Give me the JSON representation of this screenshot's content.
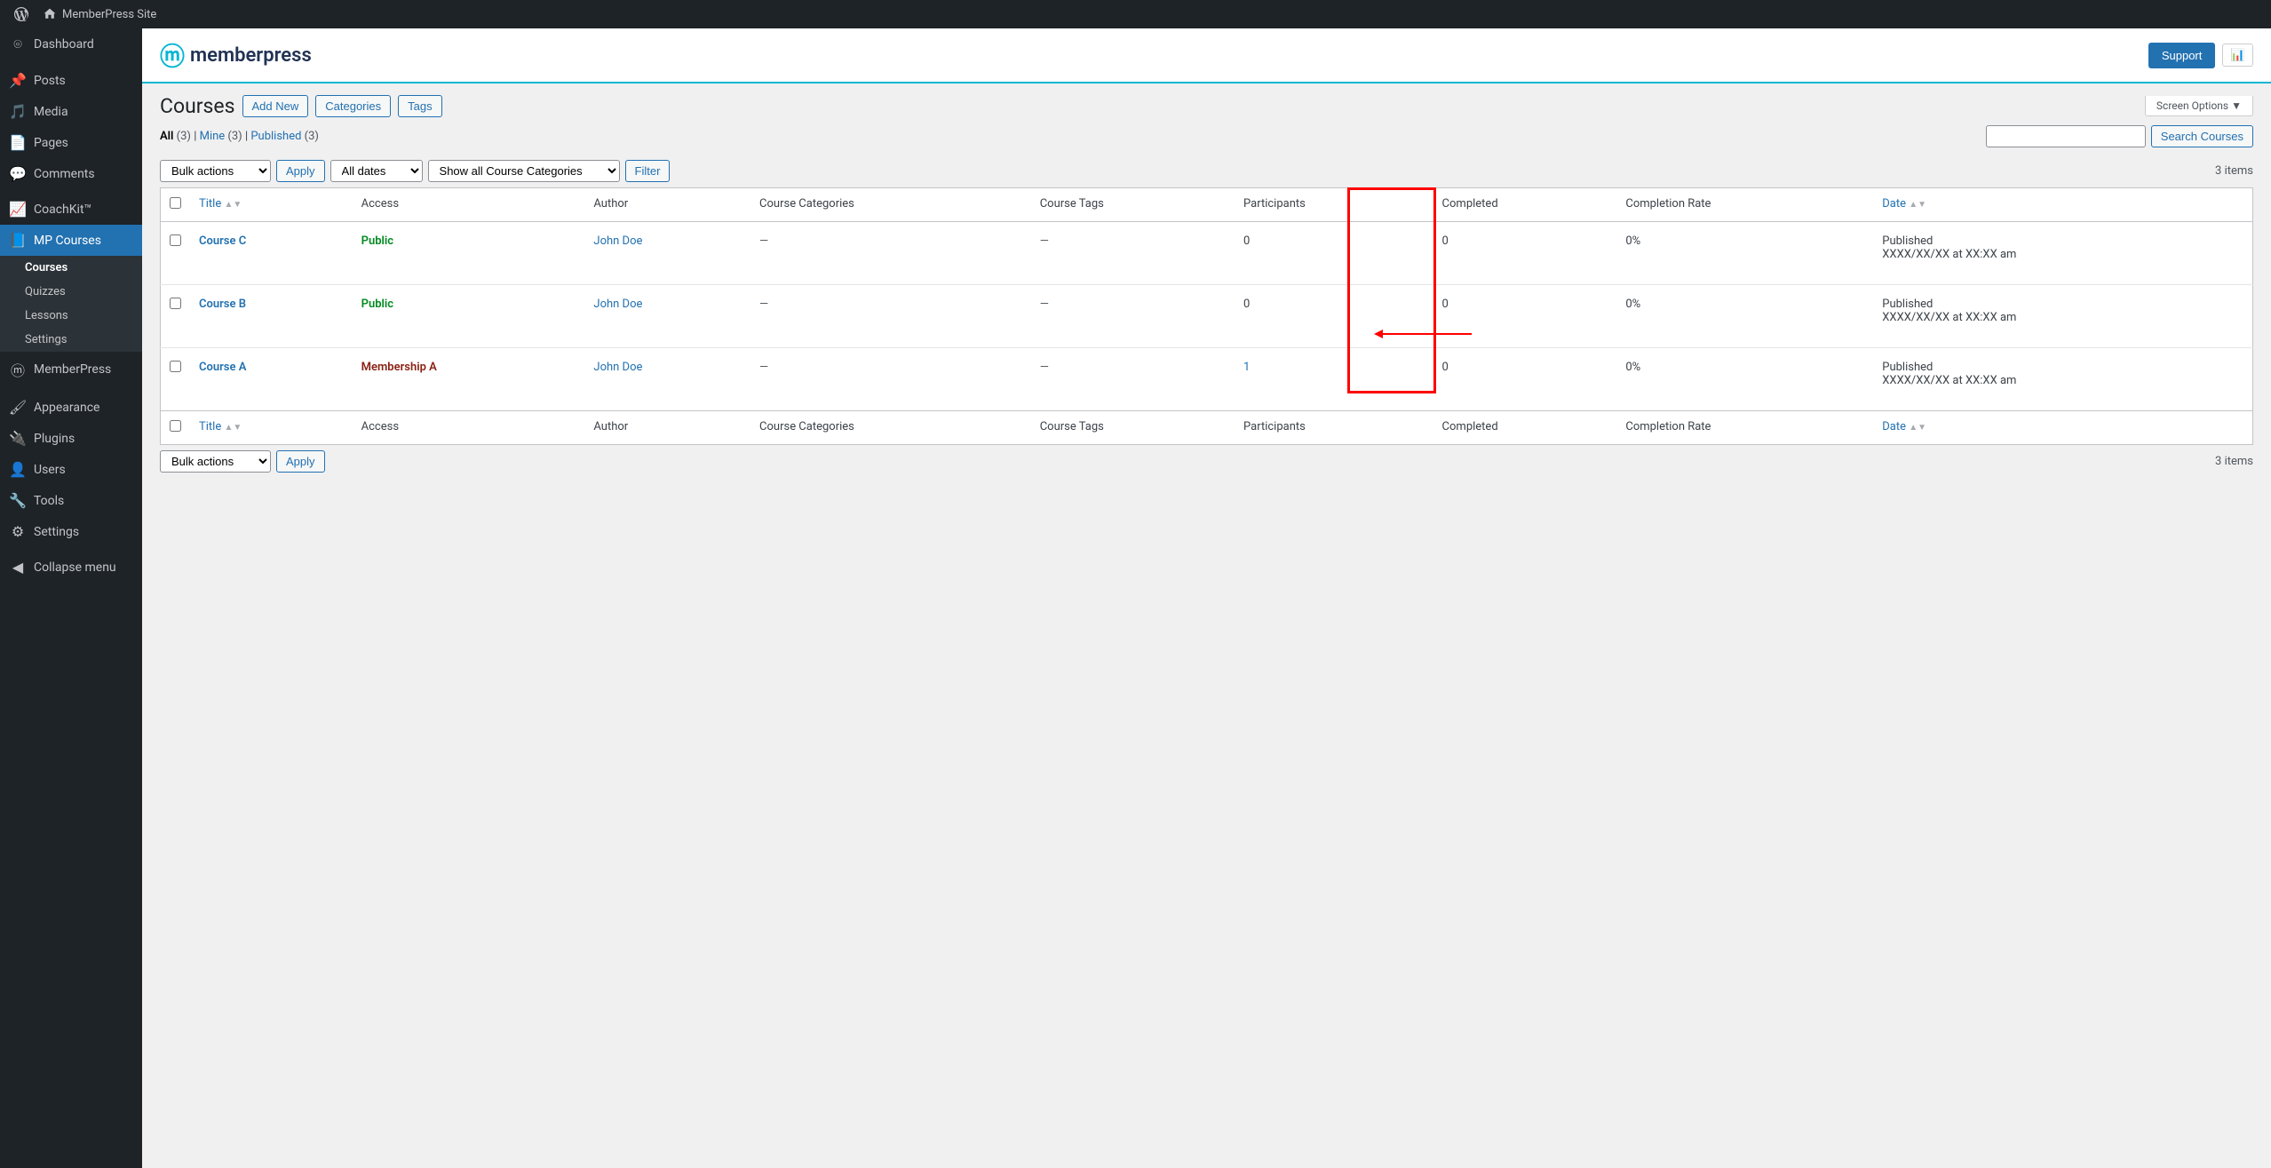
{
  "adminbar": {
    "site_name": "MemberPress Site"
  },
  "sidebar": {
    "items": [
      {
        "label": "Dashboard",
        "icon": "speedometer"
      },
      {
        "label": "Posts",
        "icon": "pin"
      },
      {
        "label": "Media",
        "icon": "media"
      },
      {
        "label": "Pages",
        "icon": "page"
      },
      {
        "label": "Comments",
        "icon": "comment"
      },
      {
        "label": "CoachKit™",
        "icon": "chart"
      },
      {
        "label": "MP Courses",
        "icon": "book",
        "current": true
      },
      {
        "label": "MemberPress",
        "icon": "m"
      },
      {
        "label": "Appearance",
        "icon": "brush"
      },
      {
        "label": "Plugins",
        "icon": "plug"
      },
      {
        "label": "Users",
        "icon": "user"
      },
      {
        "label": "Tools",
        "icon": "wrench"
      },
      {
        "label": "Settings",
        "icon": "sliders"
      },
      {
        "label": "Collapse menu",
        "icon": "collapse"
      }
    ],
    "submenu": [
      {
        "label": "Courses",
        "current": true
      },
      {
        "label": "Quizzes"
      },
      {
        "label": "Lessons"
      },
      {
        "label": "Settings"
      }
    ]
  },
  "header": {
    "brand": "memberpress",
    "support_label": "Support"
  },
  "page": {
    "title": "Courses",
    "add_new": "Add New",
    "categories": "Categories",
    "tags": "Tags",
    "screen_options": "Screen Options"
  },
  "filters": {
    "all": "All",
    "all_count": "(3)",
    "mine": "Mine",
    "mine_count": "(3)",
    "published": "Published",
    "published_count": "(3)",
    "search_button": "Search Courses",
    "bulk_actions": "Bulk actions",
    "apply": "Apply",
    "all_dates": "All dates",
    "show_all_cats": "Show all Course Categories",
    "filter": "Filter",
    "items_count": "3 items"
  },
  "columns": {
    "title": "Title",
    "access": "Access",
    "author": "Author",
    "categories": "Course Categories",
    "tags": "Course Tags",
    "participants": "Participants",
    "completed": "Completed",
    "completion_rate": "Completion Rate",
    "date": "Date"
  },
  "rows": [
    {
      "title": "Course C",
      "access": "Public",
      "access_class": "access-public",
      "author": "John Doe",
      "categories": "—",
      "tags": "—",
      "participants": "0",
      "participants_link": false,
      "completed": "0",
      "completion_rate": "0%",
      "status": "Published",
      "datetime": "XXXX/XX/XX at XX:XX am"
    },
    {
      "title": "Course B",
      "access": "Public",
      "access_class": "access-public",
      "author": "John Doe",
      "categories": "—",
      "tags": "—",
      "participants": "0",
      "participants_link": false,
      "completed": "0",
      "completion_rate": "0%",
      "status": "Published",
      "datetime": "XXXX/XX/XX at XX:XX am"
    },
    {
      "title": "Course A",
      "access": "Membership A",
      "access_class": "access-membership",
      "author": "John Doe",
      "categories": "—",
      "tags": "—",
      "participants": "1",
      "participants_link": true,
      "completed": "0",
      "completion_rate": "0%",
      "status": "Published",
      "datetime": "XXXX/XX/XX at XX:XX am"
    }
  ]
}
